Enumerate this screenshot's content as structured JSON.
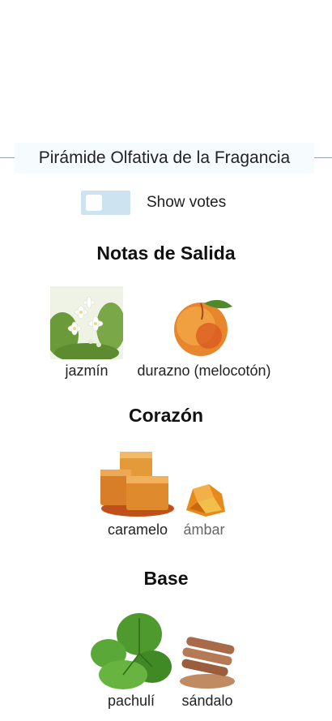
{
  "pyramid": {
    "title": "Pirámide Olfativa de la Fragancia",
    "show_votes_label": "Show votes",
    "show_votes_enabled": false
  },
  "sections": {
    "top": {
      "title": "Notas de Salida",
      "notes": [
        {
          "name": "jazmín",
          "icon": "jasmine-flower"
        },
        {
          "name": "durazno (melocotón)",
          "icon": "peach"
        }
      ]
    },
    "heart": {
      "title": "Corazón",
      "notes": [
        {
          "name": "caramelo",
          "icon": "caramel-cubes"
        },
        {
          "name": "ámbar",
          "icon": "amber-resin"
        }
      ]
    },
    "base": {
      "title": "Base",
      "notes": [
        {
          "name": "pachulí",
          "icon": "patchouli-leaves"
        },
        {
          "name": "sándalo",
          "icon": "sandalwood-sticks"
        }
      ]
    }
  },
  "colors": {
    "header_bg": "#f6fbfe",
    "header_line": "#8fa3b0",
    "toggle_bg": "#cde3f0",
    "muted_label": "#666666"
  }
}
